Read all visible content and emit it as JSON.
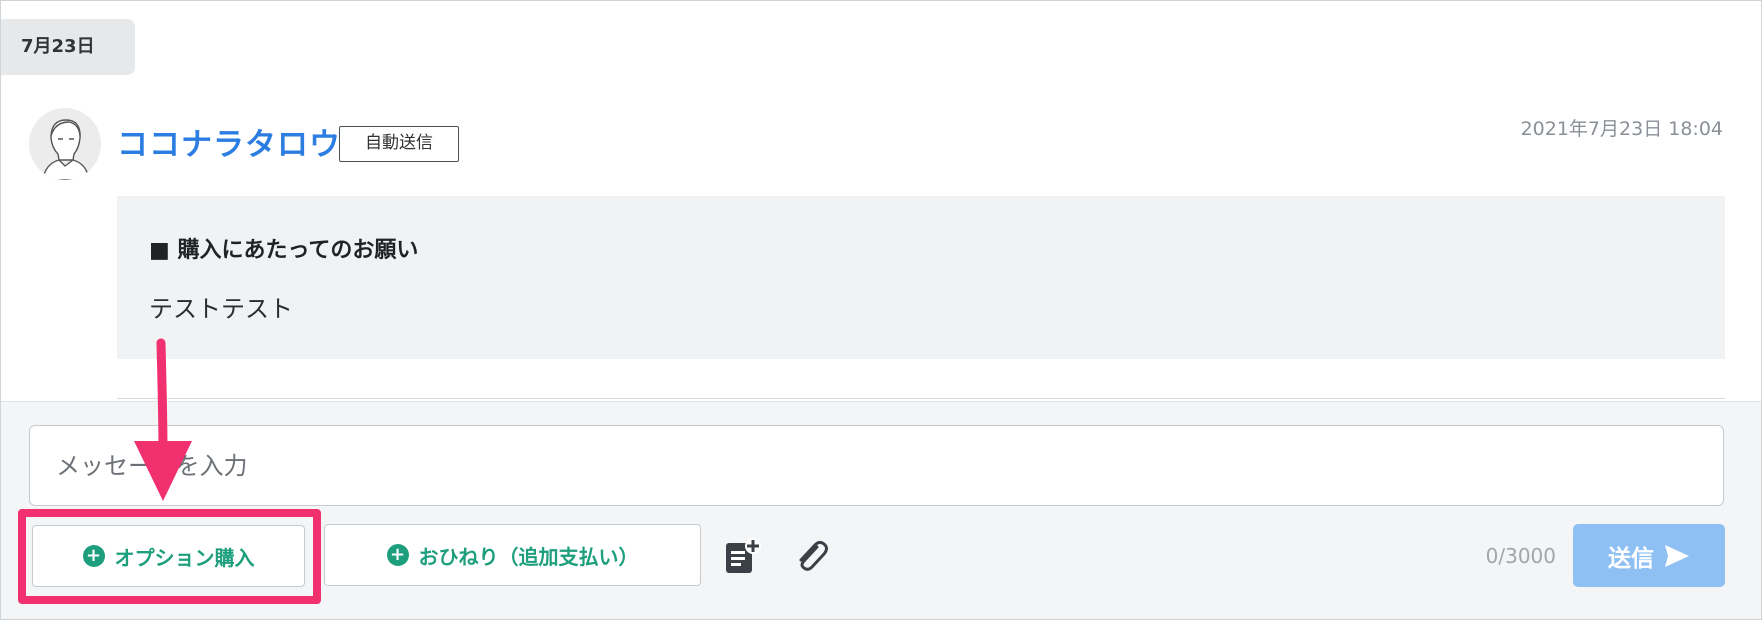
{
  "date_chip": "7月23日",
  "message": {
    "sender_name": "ココナラタロウ",
    "badge": "自動送信",
    "timestamp": "2021年7月23日 18:04",
    "title": "■ 購入にあたってのお願い",
    "body": "テストテスト"
  },
  "composer": {
    "placeholder": "メッセージを入力",
    "option_button": "オプション購入",
    "tip_button": "おひねり（追加支払い）",
    "counter": "0/3000",
    "send_label": "送信"
  },
  "icons": {
    "plus": "plus-circle-icon",
    "template": "template-note-icon",
    "attach": "paperclip-icon",
    "send": "send-arrow-icon",
    "annotation": "down-arrow-annotation"
  },
  "colors": {
    "accent_green": "#1d9f7d",
    "link_blue": "#2b7de1",
    "send_blue": "#8fc0f3",
    "highlight_pink": "#f1306f"
  }
}
